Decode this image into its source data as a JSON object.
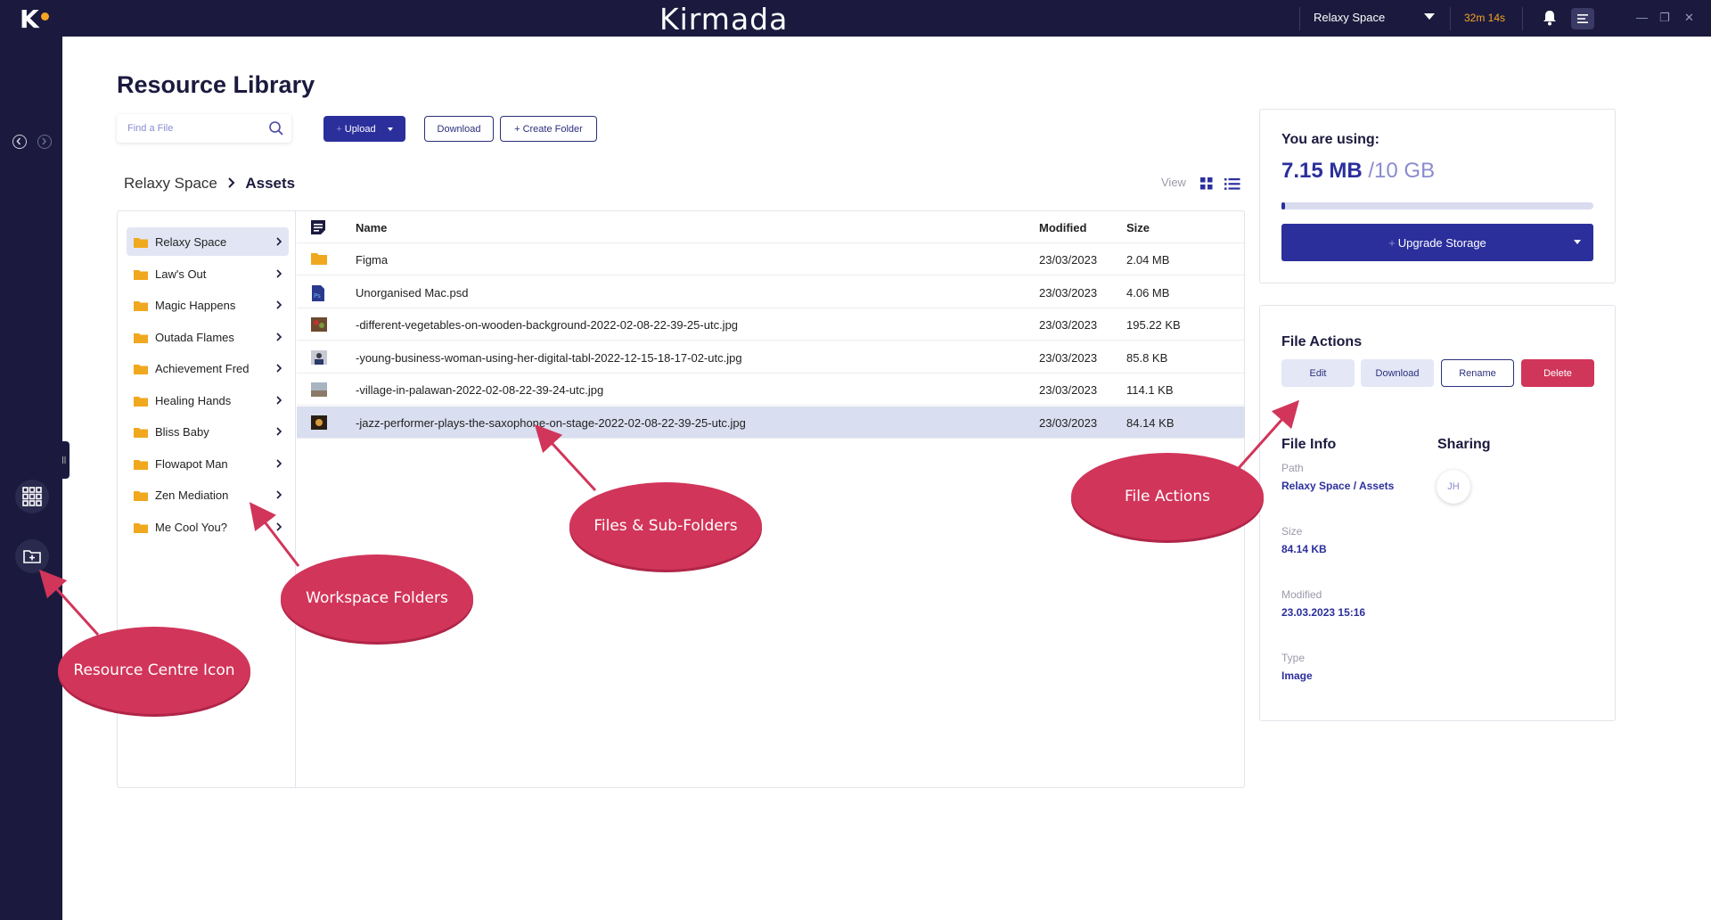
{
  "app": {
    "logo_letter": "K",
    "brand": "Kirmada"
  },
  "topbar": {
    "workspace": "Relaxy Space",
    "timer": "32m 14s"
  },
  "page": {
    "title": "Resource Library"
  },
  "toolbar": {
    "search_placeholder": "Find a File",
    "upload_label": "Upload",
    "download_label": "Download",
    "create_folder_label": "Create Folder"
  },
  "breadcrumb": {
    "root": "Relaxy Space",
    "current": "Assets"
  },
  "view": {
    "label": "View"
  },
  "folders": [
    {
      "name": "Relaxy Space"
    },
    {
      "name": "Law's Out"
    },
    {
      "name": "Magic Happens"
    },
    {
      "name": "Outada Flames"
    },
    {
      "name": "Achievement Fred"
    },
    {
      "name": "Healing Hands"
    },
    {
      "name": "Bliss Baby"
    },
    {
      "name": "Flowapot Man"
    },
    {
      "name": "Zen Mediation"
    },
    {
      "name": "Me Cool You?"
    }
  ],
  "files_table": {
    "headers": {
      "name": "Name",
      "modified": "Modified",
      "size": "Size"
    },
    "rows": [
      {
        "name": "Figma",
        "modified": "23/03/2023",
        "size": "2.04 MB",
        "icon": "folder-icon"
      },
      {
        "name": "Unorganised Mac.psd",
        "modified": "23/03/2023",
        "size": "4.06 MB",
        "icon": "psd-file-icon"
      },
      {
        "name": "-different-vegetables-on-wooden-background-2022-02-08-22-39-25-utc.jpg",
        "modified": "23/03/2023",
        "size": "195.22 KB",
        "icon": "image-thumbnail"
      },
      {
        "name": "-young-business-woman-using-her-digital-tabl-2022-12-15-18-17-02-utc.jpg",
        "modified": "23/03/2023",
        "size": "85.8 KB",
        "icon": "image-thumbnail"
      },
      {
        "name": "-village-in-palawan-2022-02-08-22-39-24-utc.jpg",
        "modified": "23/03/2023",
        "size": "114.1 KB",
        "icon": "image-thumbnail"
      },
      {
        "name": "-jazz-performer-plays-the-saxophone-on-stage-2022-02-08-22-39-25-utc.jpg",
        "modified": "23/03/2023",
        "size": "84.14 KB",
        "icon": "image-thumbnail"
      }
    ]
  },
  "usage": {
    "title": "You are using:",
    "used": "7.15 MB",
    "total": "/10 GB",
    "fraction": 0.0007,
    "upgrade_label": "Upgrade Storage"
  },
  "file_actions": {
    "title": "File Actions",
    "edit": "Edit",
    "download": "Download",
    "rename": "Rename",
    "delete": "Delete"
  },
  "file_info": {
    "title": "File Info",
    "sharing_title": "Sharing",
    "avatar_initials": "JH",
    "path_label": "Path",
    "path_value": "Relaxy Space / Assets",
    "size_label": "Size",
    "size_value": "84.14 KB",
    "modified_label": "Modified",
    "modified_value": "23.03.2023 15:16",
    "type_label": "Type",
    "type_value": "Image"
  },
  "annotations": {
    "workspace_folders": "Workspace Folders",
    "files_subfolders": "Files & Sub-Folders",
    "file_actions": "File Actions",
    "resource_icon": "Resource Centre Icon"
  },
  "colors": {
    "nav_bg": "#1b1a3e",
    "accent": "#2b2f9c",
    "danger": "#d0355a",
    "folder": "#f0a81e",
    "timer": "#f5a623"
  }
}
